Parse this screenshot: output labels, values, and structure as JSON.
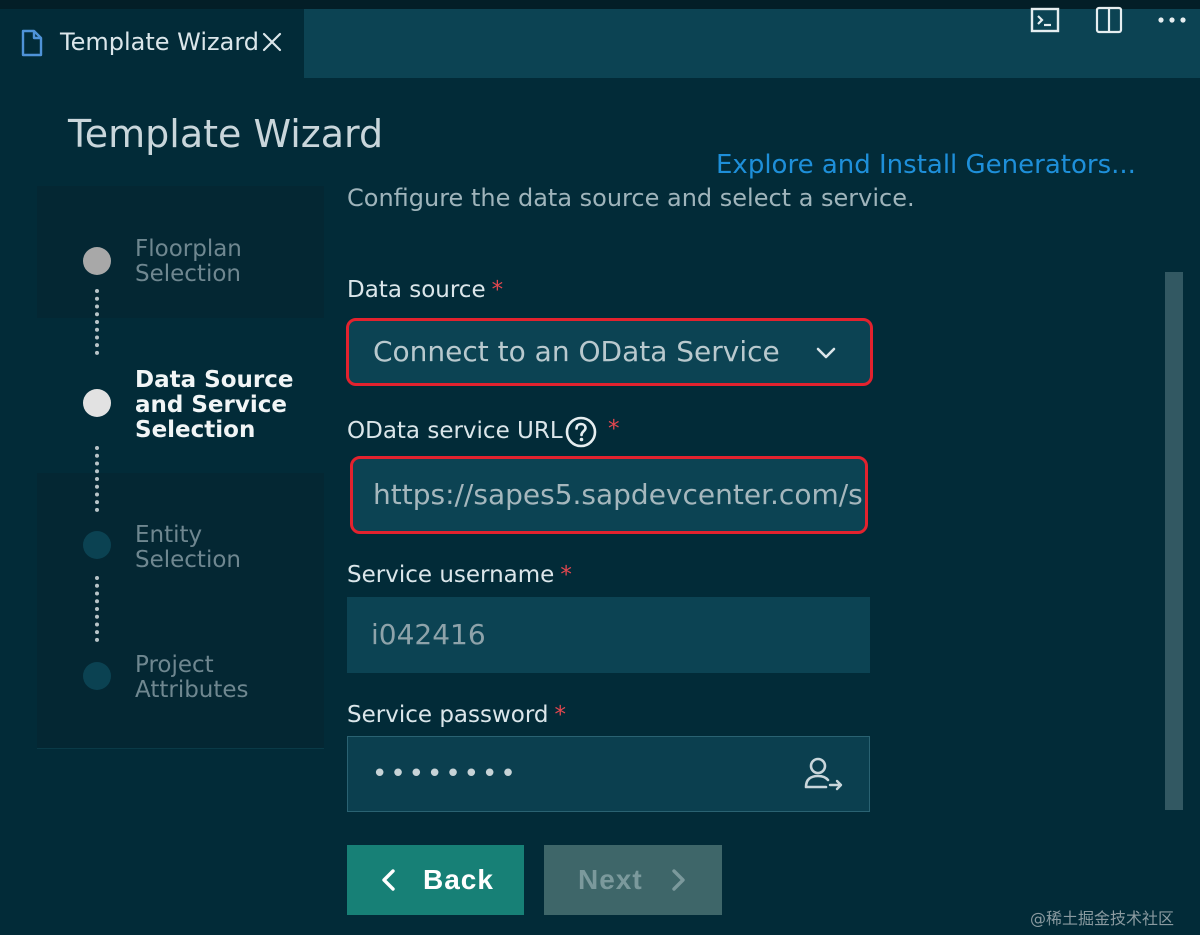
{
  "tab": {
    "title": "Template Wizard",
    "icon": "file-icon",
    "close_icon": "close-icon"
  },
  "tabbar_actions": [
    {
      "name": "open-terminal",
      "icon": "terminal-icon"
    },
    {
      "name": "split-editor",
      "icon": "split-editor-icon"
    },
    {
      "name": "more-actions",
      "icon": "ellipsis-icon"
    }
  ],
  "page": {
    "title": "Template Wizard",
    "explore_link": "Explore and Install Generators...",
    "subtitle": "Configure the data source and select a service."
  },
  "steps": [
    {
      "label": "Floorplan\nSelection",
      "state": "completed"
    },
    {
      "label": "Data Source\nand Service\nSelection",
      "state": "active"
    },
    {
      "label": "Entity\nSelection",
      "state": "pending"
    },
    {
      "label": "Project\nAttributes",
      "state": "pending"
    }
  ],
  "form": {
    "data_source": {
      "label": "Data source",
      "required_mark": "*",
      "value": "Connect to an OData Service"
    },
    "service_url": {
      "label": "OData service URL",
      "required_mark": "*",
      "value": "https://sapes5.sapdevcenter.com/s",
      "help_icon": "help-circle-icon"
    },
    "username": {
      "label": "Service username",
      "required_mark": "*",
      "value": "i042416"
    },
    "password": {
      "label": "Service password",
      "required_mark": "*",
      "value": "••••••••",
      "toggle_icon": "user-login-icon"
    }
  },
  "buttons": {
    "back": "Back",
    "next": "Next"
  },
  "watermark": "@稀土掘金技术社区",
  "colors": {
    "highlight_border": "#e3222e",
    "primary_button": "#178076",
    "link": "#1e8fd9",
    "required": "#e2474f"
  }
}
